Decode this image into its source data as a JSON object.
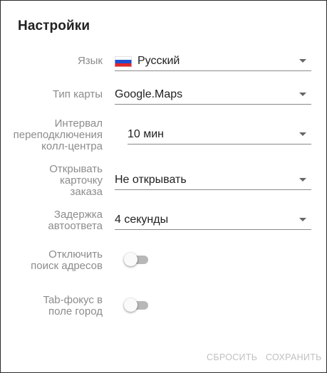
{
  "dialog": {
    "title": "Настройки"
  },
  "fields": {
    "language": {
      "label": "Язык",
      "value": "Русский",
      "flag": "russia-flag-icon"
    },
    "map_type": {
      "label": "Тип карты",
      "value": "Google.Maps"
    },
    "call_center_interval": {
      "label_lines": [
        "Интервал",
        "переподключения",
        "колл-центра"
      ],
      "value": "10 мин"
    },
    "open_order_card": {
      "label_lines": [
        "Открывать",
        "карточку",
        "заказа"
      ],
      "value": "Не открывать"
    },
    "autoresponse_delay": {
      "label_lines": [
        "Задержка",
        "автоответа"
      ],
      "value": "4 секунды"
    },
    "disable_address_search": {
      "label_lines": [
        "Отключить",
        "поиск адресов"
      ],
      "checked": false
    },
    "tab_focus_city": {
      "label_lines": [
        "Tab-фокус в",
        "поле город"
      ],
      "checked": false
    }
  },
  "actions": {
    "reset_label": "СБРОСИТЬ",
    "save_label": "СОХРАНИТЬ"
  },
  "colors": {
    "label": "#8c8c8c",
    "value_text": "#212121",
    "toggle_track_off": "#b8b8b8",
    "button_disabled": "#c0c0c0",
    "flag_white": "#ffffff",
    "flag_blue": "#1f4fd1",
    "flag_red": "#e0262b"
  }
}
